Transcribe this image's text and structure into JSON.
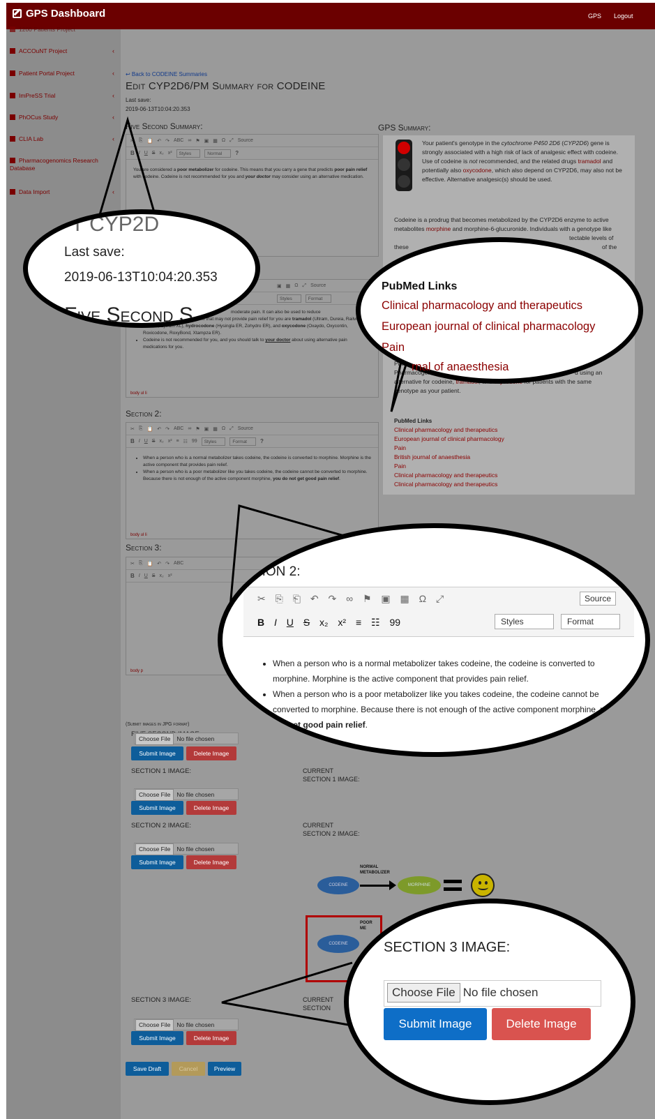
{
  "app": {
    "brand": "GPS Dashboard",
    "nav": {
      "gps": "GPS",
      "logout": "Logout"
    }
  },
  "sidebar": {
    "items": [
      {
        "label": "1200 Patients Project"
      },
      {
        "label": "ACCOuNT Project"
      },
      {
        "label": "Patient Portal Project"
      },
      {
        "label": "ImPreSS Trial"
      },
      {
        "label": "PhOCus Study"
      },
      {
        "label": "CLIA Lab"
      },
      {
        "label": "Pharmacogenomics Research"
      },
      {
        "label": "Database"
      },
      {
        "label": "Data Import"
      }
    ]
  },
  "page": {
    "back_link": "↩ Back to CODEINE Summaries",
    "title": "Edit CYP2D6/PM Summary for CODEINE",
    "last_save_label": "Last save:",
    "last_save_value": "2019-06-13T10:04:20.353"
  },
  "toolbar": {
    "source": "Source",
    "styles": "Styles",
    "normal": "Normal",
    "format": "Format",
    "help": "?"
  },
  "five_second": {
    "heading": "Five Second Summary:",
    "p_a": "You are considered a ",
    "p_b": "poor metabolizer",
    "p_c": " for codeine.  This means that you carry a gene that predicts ",
    "p_d": "poor pain relief",
    "p_e": " with codeine.  Codeine is not recommended for you and ",
    "p_f": "your doctor",
    "p_g": " may consider using an alternative medication."
  },
  "section1": {
    "line0": "moderate pain.  It can also be used to reduce",
    "bullet1_a": "Other related pain medications that may not provide pain relief for you are ",
    "bullet1_b": "tramadol",
    "bullet1_c": " (Ultram, Dureia, Railvia, Tridural, Zytram XL), ",
    "bullet1_d": "hydrocodone",
    "bullet1_e": " (Hysingla ER, Zohydro ER), and ",
    "bullet1_f": "oxycodone",
    "bullet1_g": " (Oxaydo, Oxycontin, Roxicodone, RoxyBond, Xtampza ER).",
    "bullet2_a": "Codeine is not recommended for you, and you should talk to ",
    "bullet2_b": "your doctor",
    "bullet2_c": " about using alternative pain medications for you.",
    "footer": "body  ul  li"
  },
  "section2": {
    "heading": "Section 2:",
    "bullet1": "When a person who is a normal metabolizer takes codeine, the codeine is converted to morphine.  Morphine is the active component that provides pain relief.",
    "bullet2_a": "When a person who is a poor metabolizer like you takes codeine, the codeine cannot be converted to morphine.  Because there is not enough of the active component morphine, ",
    "bullet2_b": "you do not get good pain relief",
    "bullet2_c": ".",
    "footer": "body  ul  li"
  },
  "section3": {
    "heading": "Section 3:",
    "footer": "body  p"
  },
  "gps_summary": {
    "heading": "GPS Summary:",
    "p1_a": "Your patient's genotype in the ",
    "p1_b": "cytochrome P450 2D6",
    "p1_c": " (",
    "p1_d": "CYP2D6",
    "p1_e": ") gene is strongly associated with a high risk of lack of analgesic effect with codeine. Use of codeine is ",
    "p1_f": "not",
    "p1_g": " recommended, and the related drugs ",
    "p1_h": "tramadol",
    "p1_i": " and potentially also ",
    "p1_j": "oxycodone",
    "p1_k": ", which also depend on CYP2D6, may also not be effective. Alternative analgesic(s) should be used.",
    "p2_a": "Codeine is a prodrug that becomes metabolized by the CYP2D6 enzyme to active metabolites ",
    "p2_b": "morphine",
    "p2_c": " and morphine-6-glucuronide.  Individuals with a genotype like ",
    "p2_d": "tectable levels of",
    "p2_e": "these",
    "p2_f": "of the",
    "p3_a": "Pharm",
    "p3_b": "d using an",
    "p3_c": "Pharmacogene",
    "p3_d": "alternative for codeine, ",
    "p3_e": "tramadol",
    "p3_f": ", and ",
    "p3_g": "oxycodone",
    "p3_h": " for patients with the same",
    "p3_i": "genotype as your patient.",
    "pubmed_heading": "PubMed Links",
    "links": [
      "Clinical pharmacology and therapeutics",
      "European journal of clinical pharmacology",
      "Pain",
      "British journal of anaesthesia",
      "Pain",
      "Clinical pharmacology and therapeutics",
      "Clinical pharmacology and therapeutics"
    ]
  },
  "images": {
    "note": "(Submit images in JPG format)",
    "five_second_label": "FIVE SECOND IMAGE:",
    "section1_label": "SECTION 1 IMAGE:",
    "section2_label": "SECTION 2 IMAGE:",
    "section3_label": "SECTION 3 IMAGE:",
    "current_label": "CURRENT",
    "current_s1": "SECTION 1 IMAGE:",
    "current_s2": "SECTION 2 IMAGE:",
    "current_s3_cut": "CURRENT",
    "current_s3_b": "SECTION",
    "choose_file": "Choose File",
    "no_file": "No file chosen",
    "submit": "Submit Image",
    "delete": "Delete Image"
  },
  "diagram": {
    "codeine": "CODEINE",
    "morphine": "MORPHINE",
    "normal_a": "NORMAL",
    "normal_b": "METABOLIZER",
    "poor_a": "POOR",
    "poor_b": "ME"
  },
  "actions": {
    "save_draft": "Save Draft",
    "cancel": "Cancel",
    "preview": "Preview"
  },
  "callouts": {
    "save_partial": "T CYP2D",
    "five_partial": "Five Second S",
    "section2_partial": "TION 2:",
    "pubmed_links": [
      "Clinical pharmacology and therapeutics",
      "European journal of clinical pharmacology",
      "Pain",
      "rnal of anaesthesia"
    ]
  },
  "colors": {
    "header": "#6b0000",
    "link_red": "#8b0000",
    "button_blue": "#0e6ec7",
    "button_red": "#d9534f"
  }
}
